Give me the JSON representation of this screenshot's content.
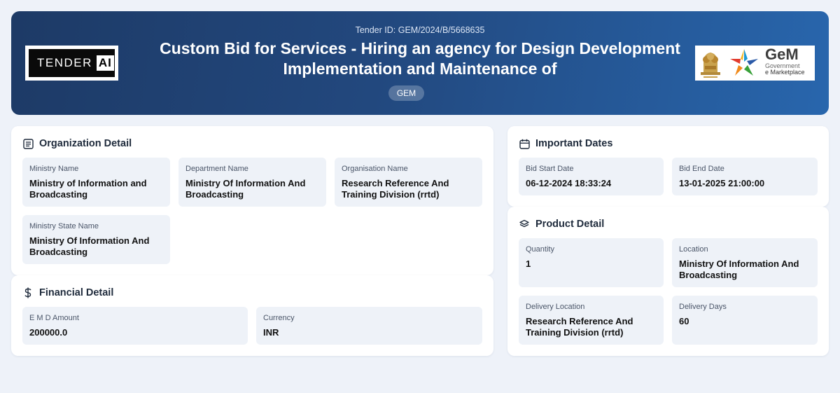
{
  "header": {
    "tender_id": "Tender ID: GEM/2024/B/5668635",
    "title": "Custom Bid for Services - Hiring an agency for Design Development Implementation and Maintenance of",
    "badge": "GEM",
    "logo_left": {
      "text1": "TENDER",
      "text2": "AI"
    },
    "logo_right": {
      "name": "GeM",
      "line1": "Government",
      "line2": "e Marketplace",
      "emblem_icon": "national-emblem-icon",
      "star_icon": "gem-star-icon"
    }
  },
  "organization": {
    "title": "Organization Detail",
    "icon": "document-list-icon",
    "fields": [
      {
        "label": "Ministry Name",
        "value": "Ministry of Information and Broadcasting"
      },
      {
        "label": "Department Name",
        "value": "Ministry Of Information And Broadcasting"
      },
      {
        "label": "Organisation Name",
        "value": "Research Reference And Training Division (rrtd)"
      },
      {
        "label": "Ministry State Name",
        "value": "Ministry Of Information And Broadcasting"
      }
    ]
  },
  "financial": {
    "title": "Financial Detail",
    "icon": "dollar-icon",
    "fields": [
      {
        "label": "E M D Amount",
        "value": "200000.0"
      },
      {
        "label": "Currency",
        "value": "INR"
      }
    ]
  },
  "dates": {
    "title": "Important Dates",
    "icon": "calendar-icon",
    "fields": [
      {
        "label": "Bid Start Date",
        "value": "06-12-2024 18:33:24"
      },
      {
        "label": "Bid End Date",
        "value": "13-01-2025 21:00:00"
      }
    ]
  },
  "product": {
    "title": "Product Detail",
    "icon": "layers-icon",
    "fields": [
      {
        "label": "Quantity",
        "value": "1"
      },
      {
        "label": "Location",
        "value": "Ministry Of Information And Broadcasting"
      },
      {
        "label": "Delivery Location",
        "value": "Research Reference And Training Division (rrtd)"
      },
      {
        "label": "Delivery Days",
        "value": "60"
      }
    ]
  },
  "colors": {
    "header_start": "#1d3a66",
    "header_end": "#2866ad",
    "page_bg": "#eef2f9",
    "field_bg": "#eef2f8"
  }
}
